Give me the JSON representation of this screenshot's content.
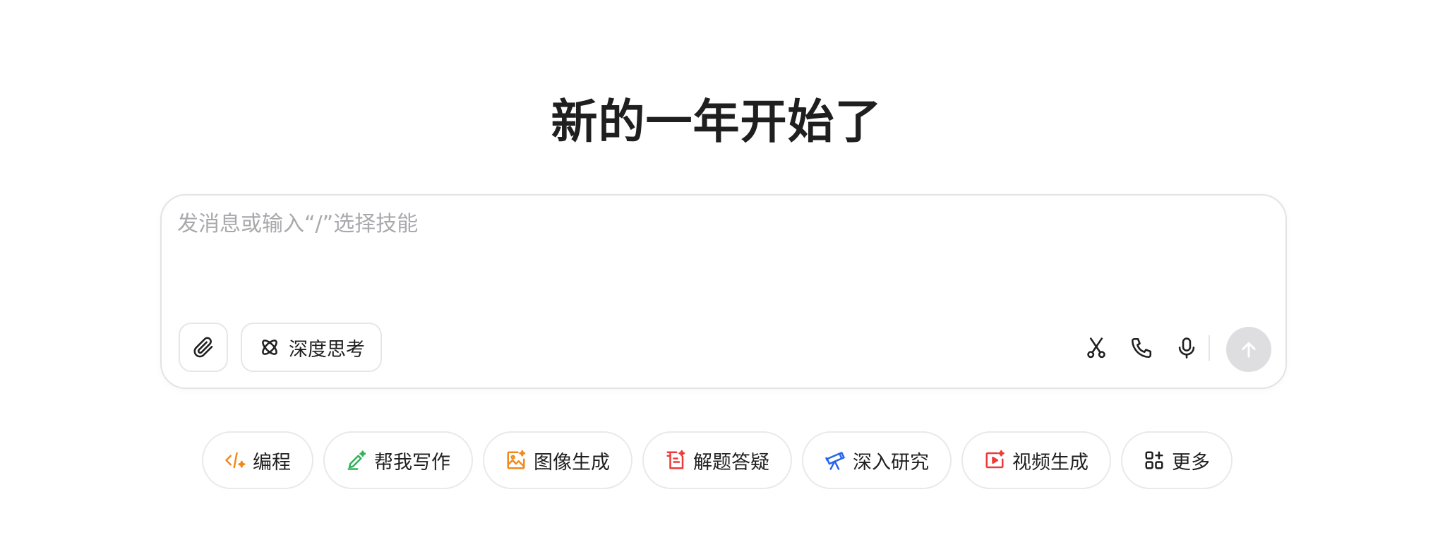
{
  "page_title": "新的一年开始了",
  "composer": {
    "placeholder": "发消息或输入“/”选择技能",
    "deep_think_label": "深度思考"
  },
  "chips": [
    {
      "label": "编程",
      "icon": "code-icon",
      "color": "#f08a1c"
    },
    {
      "label": "帮我写作",
      "icon": "pen-sparkle-icon",
      "color": "#2eb35a"
    },
    {
      "label": "图像生成",
      "icon": "image-icon",
      "color": "#f08a1c"
    },
    {
      "label": "解题答疑",
      "icon": "problem-solving-icon",
      "color": "#ee3a3a"
    },
    {
      "label": "深入研究",
      "icon": "telescope-icon",
      "color": "#2463eb"
    },
    {
      "label": "视频生成",
      "icon": "video-icon",
      "color": "#ee3a3a"
    },
    {
      "label": "更多",
      "icon": "grid-plus-icon",
      "color": "#1f1f1f"
    }
  ],
  "colors": {
    "send_button_disabled": "#dedee0",
    "border": "#e3e3e6",
    "placeholder": "#a9a9ad"
  }
}
